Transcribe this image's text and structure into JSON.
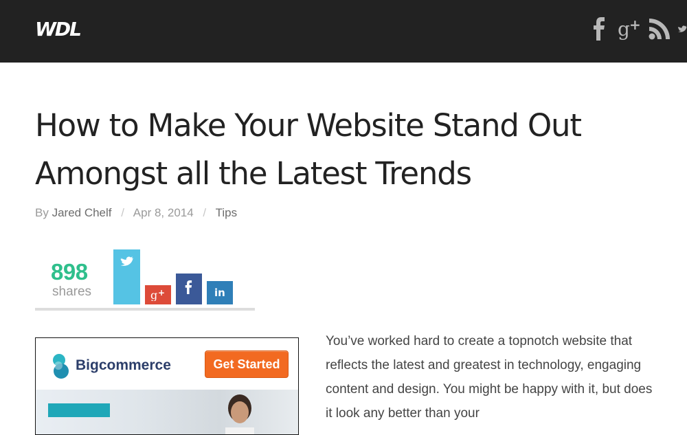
{
  "header": {
    "logo": "WDL",
    "icons": [
      "facebook-icon",
      "google-plus-icon",
      "rss-icon",
      "twitter-icon"
    ],
    "background": "#222222"
  },
  "article": {
    "title": "How to Make Your Website Stand Out Amongst all the Latest Trends",
    "meta": {
      "by_label": "By",
      "author": "Jared Chelf",
      "date": "Apr 8, 2014",
      "category": "Tips"
    },
    "body": "You’ve worked hard to create a topnotch website that reflects the latest and greatest in technology, engaging content and design. You might be happy with it, but does it look any better than your"
  },
  "share": {
    "count": "898",
    "label": "shares",
    "accent": "#2fbf8c",
    "buttons": [
      {
        "name": "twitter",
        "icon": "twitter-icon",
        "color": "#55c3e4",
        "level": 0.95
      },
      {
        "name": "google-plus",
        "icon": "google-plus-icon",
        "color": "#dd4b39",
        "level": 0.33
      },
      {
        "name": "facebook",
        "icon": "facebook-icon",
        "color": "#3b5998",
        "level": 0.53
      },
      {
        "name": "linkedin",
        "icon": "linkedin-icon",
        "color": "#2f7fb8",
        "level": 0.4
      }
    ]
  },
  "ad": {
    "brand": "Bigcommerce",
    "cta": "Get Started",
    "cta_color": "#f26a21"
  }
}
